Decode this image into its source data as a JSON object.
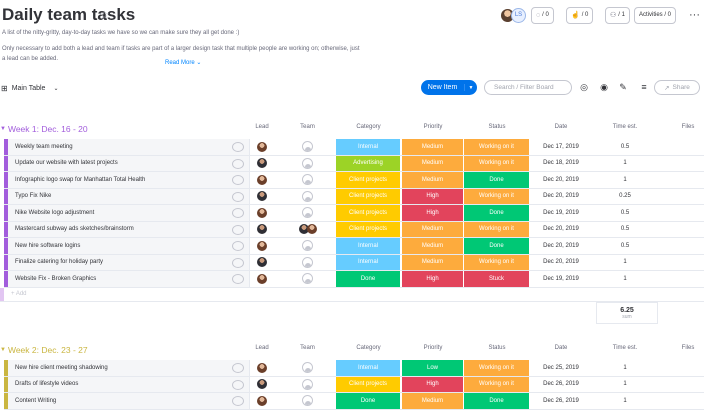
{
  "board": {
    "title": "Daily team tasks",
    "description_1": "A list of the nitty-gritty, day-to-day tasks we have so we can make sure they all get done :)",
    "description_2": "Only necessary to add both a lead and team if tasks are part of a larger design task that multiple people are working on; otherwise, just a lead can be added.",
    "read_more": "Read More"
  },
  "header": {
    "avatar_initials": "LS",
    "updates_count": "/ 0",
    "likes_count": "/ 0",
    "members_count": "/ 1",
    "activities_label": "Activities / 0",
    "more_label": "···"
  },
  "toolbar": {
    "view_label": "Main Table",
    "new_item_label": "New Item",
    "search_placeholder": "Search / Filter Board",
    "share_label": "Share"
  },
  "columns": [
    "Lead",
    "Team",
    "Category",
    "Priority",
    "Status",
    "Date",
    "Time est.",
    "Files"
  ],
  "colors": {
    "group1": "#a25ddc",
    "group2": "#cab641",
    "internal": "#66ccff",
    "advertising": "#9cd326",
    "client": "#fdbc64",
    "clientprojects": "#ffcb00",
    "done": "#00c875",
    "medium": "#fdab3d",
    "high": "#e2445c",
    "low": "#00c875",
    "working": "#fdab3d",
    "stuck": "#e2445c"
  },
  "groups": [
    {
      "title": "Week 1: Dec. 16 - 20",
      "add_label": "+ Add",
      "sum_value": "6.25",
      "sum_label": "sum",
      "rows": [
        {
          "name": "Weekly team meeting",
          "team": "empty",
          "category": "Internal",
          "priority": "Medium",
          "status": "Working on it",
          "date": "Dec 17, 2019",
          "time": "0.5"
        },
        {
          "name": "Update our website with latest projects",
          "team": "empty",
          "category": "Advertising",
          "priority": "Medium",
          "status": "Working on it",
          "date": "Dec 18, 2019",
          "time": "1"
        },
        {
          "name": "Infographic logo swap for Manhattan Total Health",
          "team": "empty",
          "category": "Client projects",
          "priority": "Medium",
          "status": "Done",
          "date": "Dec 20, 2019",
          "time": "1"
        },
        {
          "name": "Typo Fix Nike",
          "team": "empty",
          "category": "Client projects",
          "priority": "High",
          "status": "Working on it",
          "date": "Dec 20, 2019",
          "time": "0.25"
        },
        {
          "name": "Nike Website logo adjustment",
          "team": "empty",
          "category": "Client projects",
          "priority": "High",
          "status": "Done",
          "date": "Dec 19, 2019",
          "time": "0.5"
        },
        {
          "name": "Mastercard subway ads sketches/brainstorm",
          "team": "two",
          "category": "Client projects",
          "priority": "Medium",
          "status": "Working on it",
          "date": "Dec 20, 2019",
          "time": "0.5"
        },
        {
          "name": "New hire software logins",
          "team": "empty",
          "category": "Internal",
          "priority": "Medium",
          "status": "Done",
          "date": "Dec 20, 2019",
          "time": "0.5"
        },
        {
          "name": "Finalize catering for holiday party",
          "team": "empty",
          "category": "Internal",
          "priority": "Medium",
          "status": "Working on it",
          "date": "Dec 20, 2019",
          "time": "1"
        },
        {
          "name": "Website Fix - Broken Graphics",
          "team": "empty",
          "category": "Done",
          "priority": "High",
          "status": "Stuck",
          "date": "Dec 19, 2019",
          "time": "1"
        }
      ]
    },
    {
      "title": "Week 2: Dec. 23 - 27",
      "rows": [
        {
          "name": "New hire client meeting shadowing",
          "team": "empty",
          "category": "Internal",
          "priority": "Low",
          "status": "Working on it",
          "date": "Dec 25, 2019",
          "time": "1"
        },
        {
          "name": "Drafts of lifestyle videos",
          "team": "empty",
          "category": "Client projects",
          "priority": "High",
          "status": "Working on it",
          "date": "Dec 26, 2019",
          "time": "1"
        },
        {
          "name": "Content Writing",
          "team": "empty",
          "category": "Done",
          "priority": "Medium",
          "status": "Done",
          "date": "Dec 26, 2019",
          "time": "1"
        }
      ]
    }
  ]
}
